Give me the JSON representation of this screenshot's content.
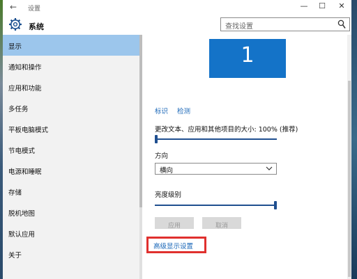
{
  "window": {
    "title": "设置",
    "back_icon": "back-arrow-icon",
    "controls": {
      "minimize": "—",
      "maximize": "☐",
      "close": "✕"
    }
  },
  "header": {
    "section_title": "系统",
    "icon": "gear-icon",
    "search": {
      "placeholder": "查找设置"
    }
  },
  "sidebar": {
    "items": [
      {
        "label": "显示",
        "active": true
      },
      {
        "label": "通知和操作",
        "active": false
      },
      {
        "label": "应用和功能",
        "active": false
      },
      {
        "label": "多任务",
        "active": false
      },
      {
        "label": "平板电脑模式",
        "active": false
      },
      {
        "label": "节电模式",
        "active": false
      },
      {
        "label": "电源和睡眠",
        "active": false
      },
      {
        "label": "存储",
        "active": false
      },
      {
        "label": "脱机地图",
        "active": false
      },
      {
        "label": "默认应用",
        "active": false
      },
      {
        "label": "关于",
        "active": false
      }
    ]
  },
  "display": {
    "monitor_number": "1",
    "identify_link": "标识",
    "detect_link": "检测",
    "scale_label": "更改文本、应用和其他项目的大小: 100% (推荐)",
    "scale_level": 0,
    "orientation_label": "方向",
    "orientation_value": "横向",
    "brightness_label": "亮度级别",
    "brightness_level": 1.0,
    "apply_button": "应用",
    "cancel_button": "取消",
    "advanced_link": "高级显示设置"
  },
  "colors": {
    "accent": "#1473c8",
    "sidebar_active": "#9cc6ec",
    "link": "#1a67b8",
    "highlight_box": "#e0302e"
  }
}
